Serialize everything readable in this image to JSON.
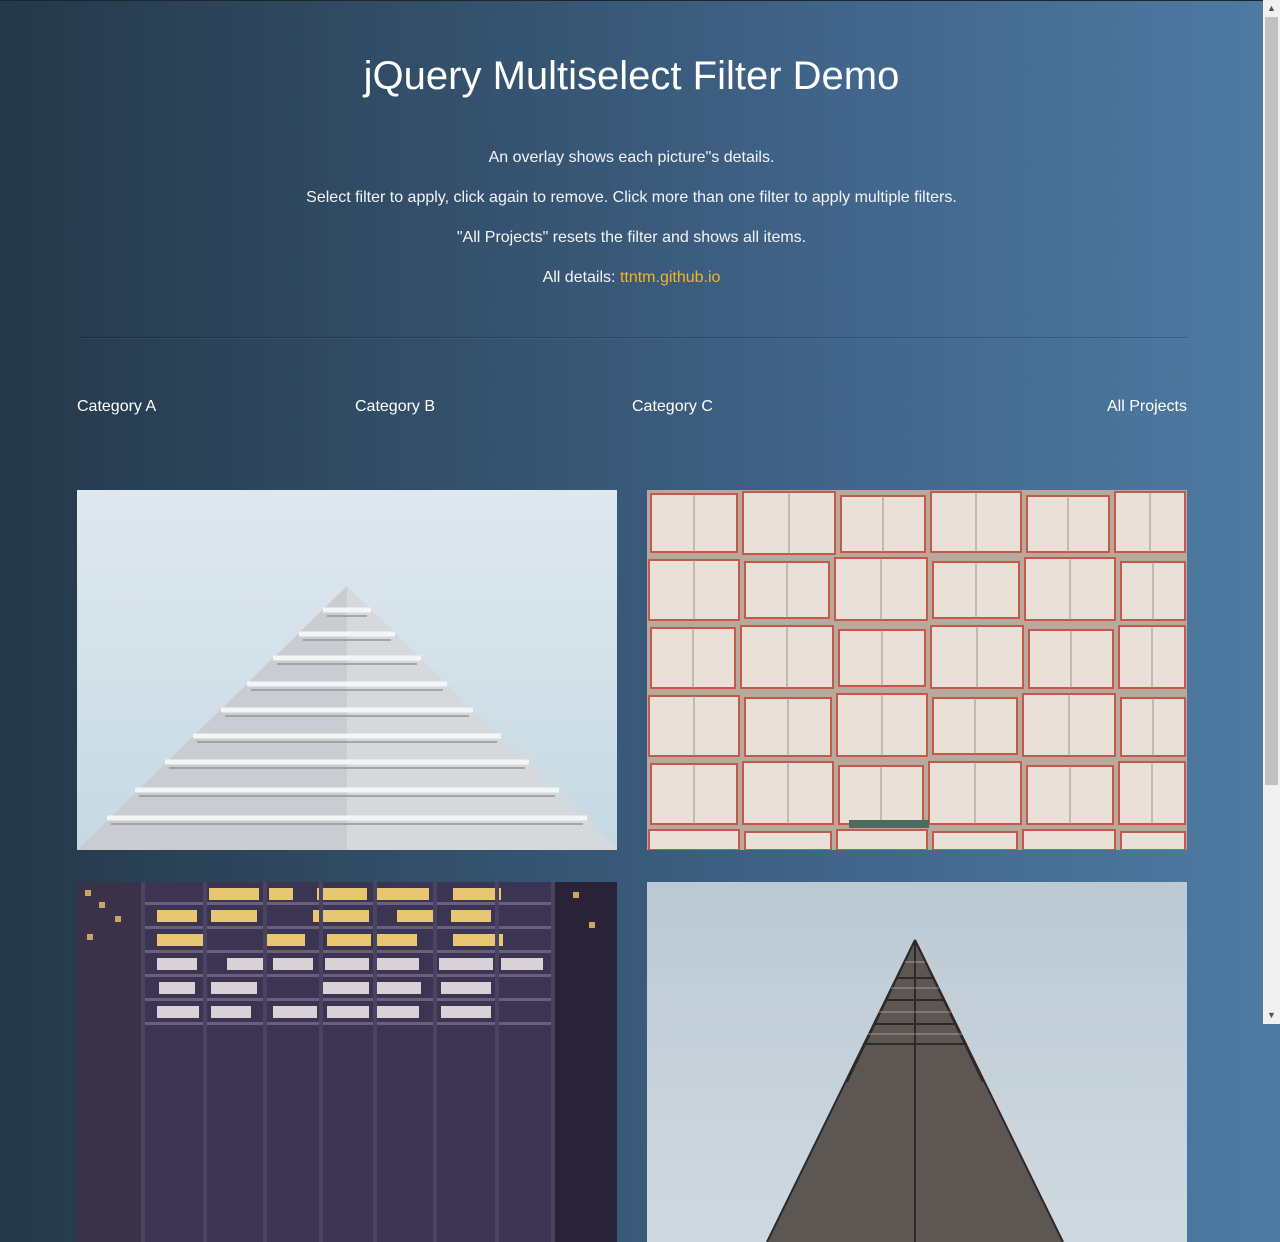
{
  "header": {
    "title": "jQuery Multiselect Filter Demo",
    "line1": "An overlay shows each picture\"s details.",
    "line2": "Select filter to apply, click again to remove. Click more than one filter to apply multiple filters.",
    "line3": "\"All Projects\" resets the filter and shows all items.",
    "details_label": "All details: ",
    "details_link": "ttntm.github.io"
  },
  "filters": [
    {
      "label": "Category A"
    },
    {
      "label": "Category B"
    },
    {
      "label": "Category C"
    },
    {
      "label": "All Projects"
    }
  ],
  "gallery": [
    {
      "icon": "white-pyramid-building-photo"
    },
    {
      "icon": "open-books-wall-photo"
    },
    {
      "icon": "night-office-building-photo"
    },
    {
      "icon": "glass-pyramid-building-photo"
    }
  ],
  "colors": {
    "background_left": "#253849",
    "background_right": "#4e7ba3",
    "link": "#f4b51f"
  }
}
